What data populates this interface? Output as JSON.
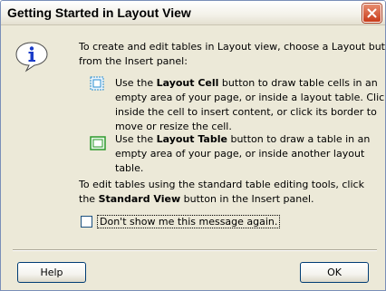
{
  "window": {
    "title": "Getting Started in Layout View"
  },
  "content": {
    "intro_line1": "To create and edit tables in Layout view, choose a Layout button",
    "intro_line2": "from the Insert panel:",
    "items": [
      {
        "prefix": "Use the ",
        "bold": "Layout Cell",
        "suffix": " button to draw table cells in an",
        "line2": "empty area of your page, or inside a layout table. Click",
        "line3": "inside the cell to insert content, or click its border to",
        "line4": "move or resize the cell.",
        "icon": "layout-cell-icon"
      },
      {
        "prefix": "Use the ",
        "bold": "Layout Table",
        "suffix": " button to draw a table in an",
        "line2": "empty area of your page, or inside another layout",
        "line3": "table.",
        "icon": "layout-table-icon"
      }
    ],
    "outro_line1": "To edit tables using the standard table editing tools, click",
    "outro_prefix": "the ",
    "outro_bold": "Standard View",
    "outro_suffix": " button in the Insert panel."
  },
  "checkbox": {
    "label": "Don't show me this message again.",
    "checked": false
  },
  "buttons": {
    "help": "Help",
    "ok": "OK"
  },
  "colors": {
    "dialog_bg": "#ece9d8",
    "close_button": "#c93c1a",
    "info_icon_blue": "#1a3cc8"
  }
}
